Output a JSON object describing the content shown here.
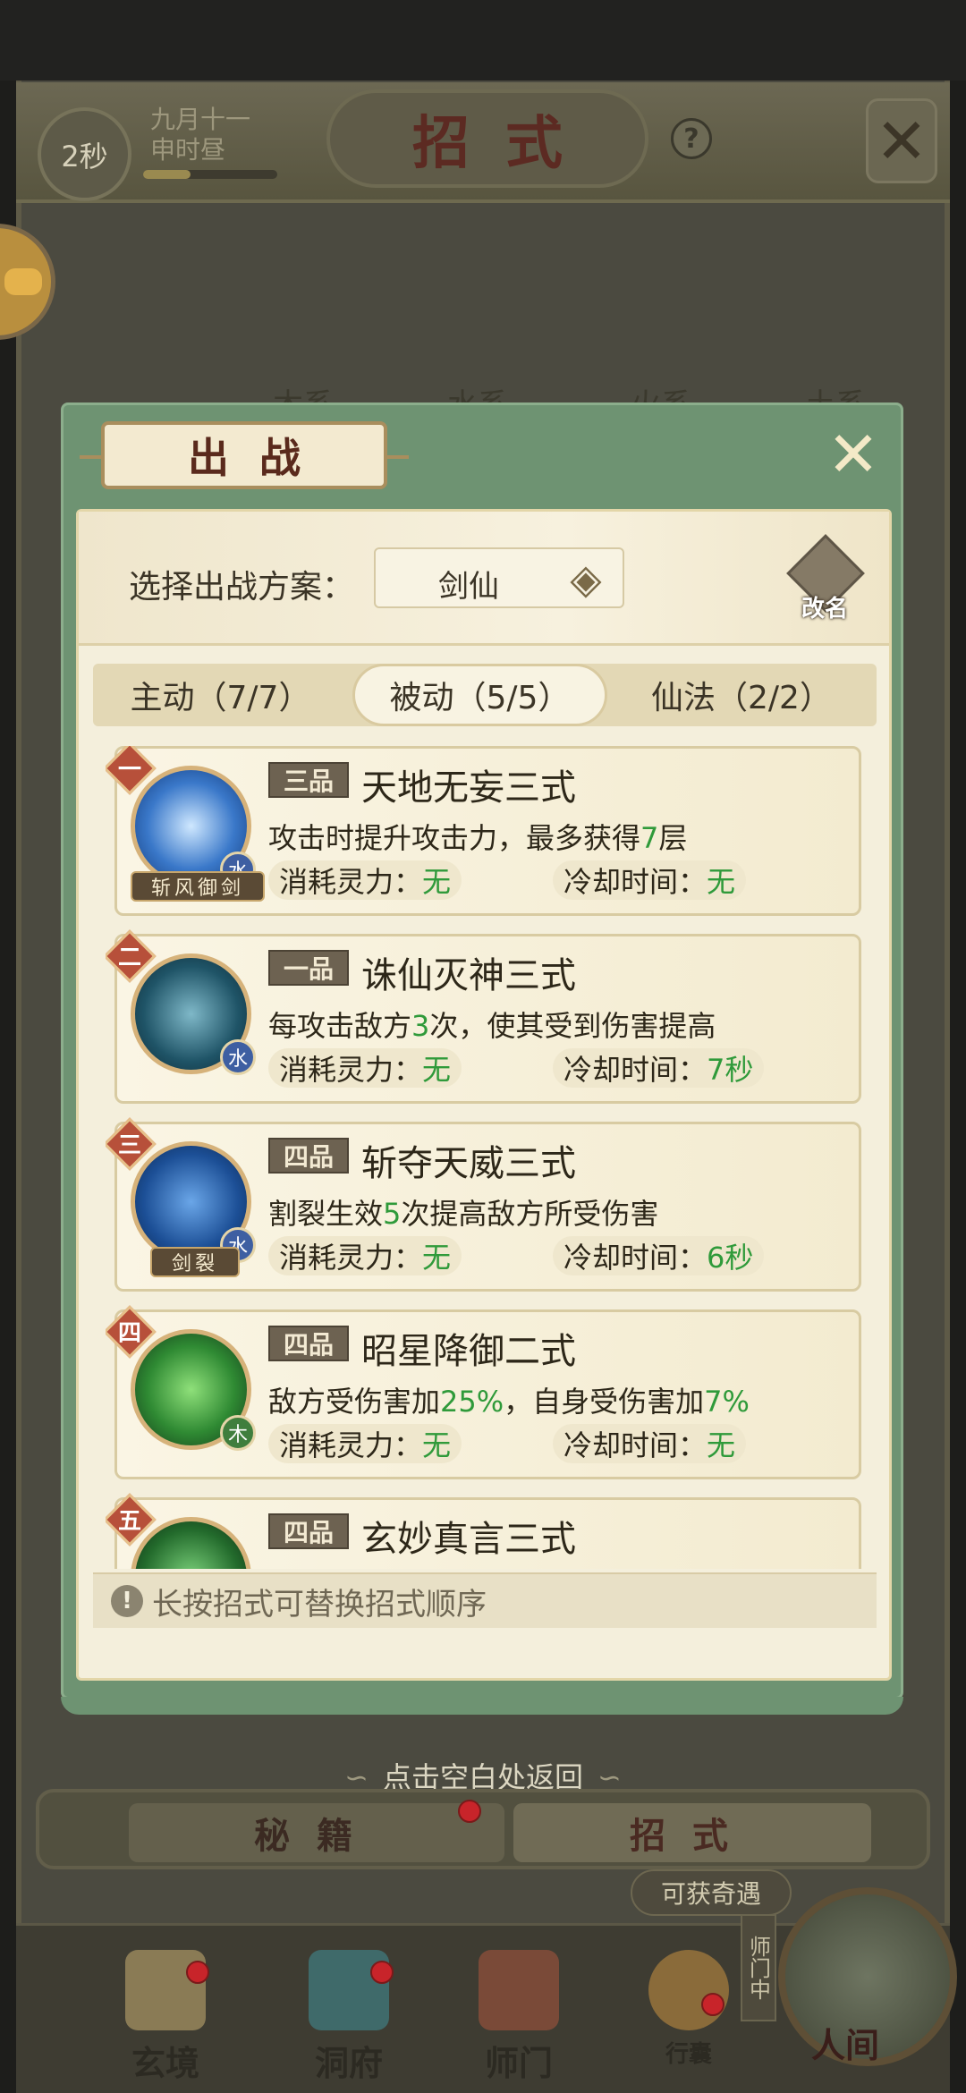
{
  "header": {
    "timer": "2秒",
    "date_line1": "九月十一",
    "date_line2": "申时昼",
    "title": "招式",
    "help": "?"
  },
  "background_tabs": [
    "木系",
    "水系",
    "火系",
    "土系"
  ],
  "modal": {
    "title": "出战",
    "plan_label": "选择出战方案：",
    "plan_value": "剑仙",
    "rename": "改名",
    "tabs": [
      {
        "label": "主动（7/7）",
        "active": false
      },
      {
        "label": "被动（5/5）",
        "active": true
      },
      {
        "label": "仙法（2/2）",
        "active": false
      }
    ],
    "cost_label": "消耗灵力：",
    "cooldown_label": "冷却时间：",
    "skills": [
      {
        "rank": "一",
        "quality": "三品",
        "name": "天地无妄三式",
        "desc_parts": [
          "攻击时提升攻击力，最多获得",
          "7",
          "层"
        ],
        "element": "水",
        "tag": "斩风御剑",
        "cost": "无",
        "cooldown": "无"
      },
      {
        "rank": "二",
        "quality": "一品",
        "name": "诛仙灭神三式",
        "desc_parts": [
          "每攻击敌方",
          "3",
          "次，使其受到伤害提高"
        ],
        "element": "水",
        "tag": "",
        "cost": "无",
        "cooldown": "7秒"
      },
      {
        "rank": "三",
        "quality": "四品",
        "name": "斩夺天威三式",
        "desc_parts": [
          "割裂生效",
          "5",
          "次提高敌方所受伤害"
        ],
        "element": "水",
        "tag": "剑裂",
        "cost": "无",
        "cooldown": "6秒"
      },
      {
        "rank": "四",
        "quality": "四品",
        "name": "昭星降御二式",
        "desc_parts": [
          "敌方受伤害加",
          "25%",
          "，自身受伤害加",
          "7%"
        ],
        "element": "木",
        "tag": "",
        "cost": "无",
        "cooldown": "无"
      },
      {
        "rank": "五",
        "quality": "四品",
        "name": "玄妙真言三式"
      }
    ],
    "tip": "长按招式可替换招式顺序"
  },
  "return_hint": "点击空白处返回",
  "bottom_tabs": [
    "秘籍",
    "招式"
  ],
  "encounter": "可获奇遇",
  "sect_tag": "师门中",
  "nav": [
    "玄境",
    "洞府",
    "师门",
    "行囊",
    "人间"
  ],
  "colors": {
    "modal_green": "#6e9372",
    "accent_red": "#b7503a",
    "value_green": "#2f9a3a"
  }
}
